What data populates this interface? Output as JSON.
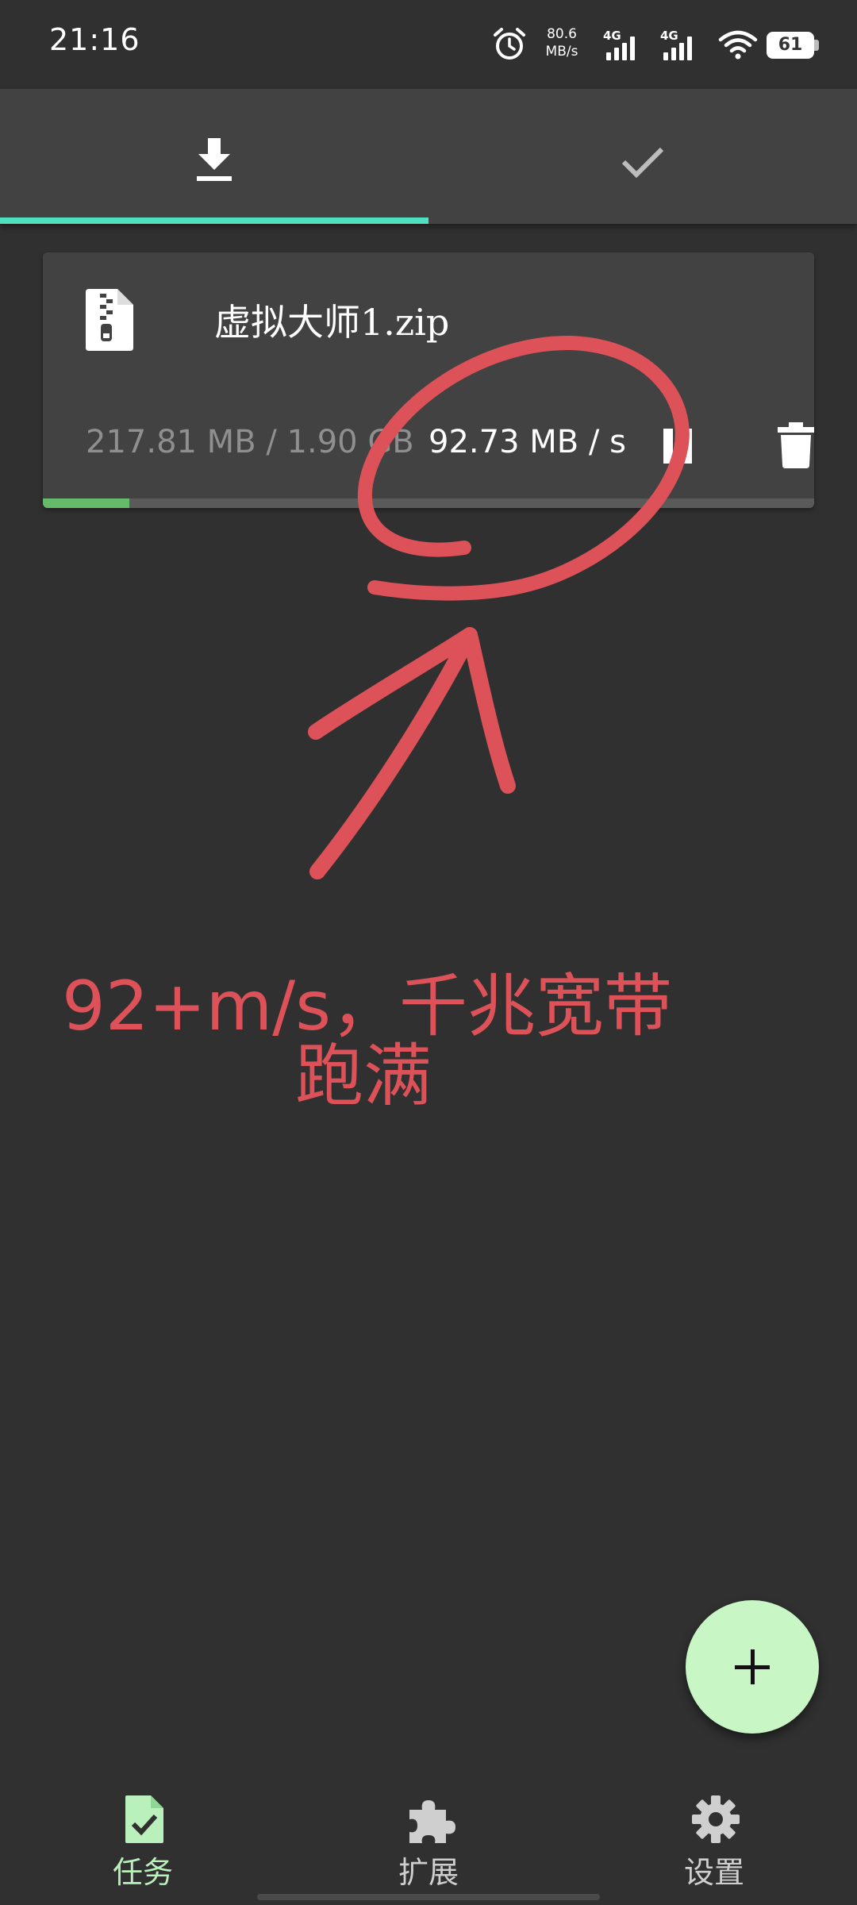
{
  "status_bar": {
    "time": "21:16",
    "net_speed_value": "80.6",
    "net_speed_unit": "MB/s",
    "sim1_label": "4G",
    "sim2_label": "4G",
    "battery": "61"
  },
  "tabs": [
    {
      "name": "download",
      "icon": "download-icon",
      "selected": true
    },
    {
      "name": "done",
      "icon": "check-icon",
      "selected": false
    }
  ],
  "task": {
    "file_name": "虚拟大师1.zip",
    "progress_text": "217.81 MB / 1.90 GB",
    "speed": "92.73 MB / s",
    "progress_fraction": 0.112
  },
  "annotation": {
    "line1": "92+m/s，千兆宽带",
    "line2": "跑满",
    "color": "#dc5258"
  },
  "fab": {
    "icon": "plus-icon"
  },
  "bottom_nav": {
    "items": [
      {
        "label": "任务",
        "icon": "task-check-icon",
        "active": true
      },
      {
        "label": "扩展",
        "icon": "puzzle-icon",
        "active": false
      },
      {
        "label": "设置",
        "icon": "gear-icon",
        "active": false
      }
    ]
  },
  "colors": {
    "background": "#303030",
    "surface": "#424242",
    "tab_indicator": "#4fe0c0",
    "progress": "#66bb6a",
    "fab": "#c8f7c5",
    "active_nav": "#b9f0bc"
  }
}
